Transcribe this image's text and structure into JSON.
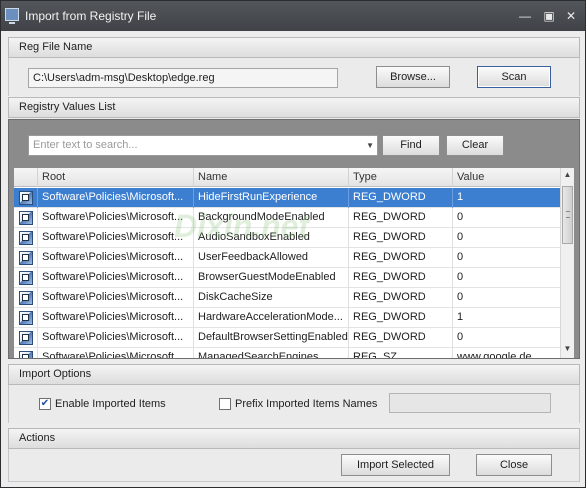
{
  "window": {
    "title": "Import from Registry File"
  },
  "reg_file": {
    "header": "Reg File Name",
    "path": "C:\\Users\\adm-msg\\Desktop\\edge.reg",
    "browse_label": "Browse...",
    "scan_label": "Scan"
  },
  "registry_values": {
    "header": "Registry Values List",
    "search_placeholder": "Enter text to search...",
    "find_label": "Find",
    "clear_label": "Clear",
    "columns": [
      "Root",
      "Name",
      "Type",
      "Value"
    ],
    "rows": [
      {
        "root": "Software\\Policies\\Microsoft...",
        "name": "HideFirstRunExperience",
        "type": "REG_DWORD",
        "value": "1",
        "selected": true
      },
      {
        "root": "Software\\Policies\\Microsoft...",
        "name": "BackgroundModeEnabled",
        "type": "REG_DWORD",
        "value": "0"
      },
      {
        "root": "Software\\Policies\\Microsoft...",
        "name": "AudioSandboxEnabled",
        "type": "REG_DWORD",
        "value": "0"
      },
      {
        "root": "Software\\Policies\\Microsoft...",
        "name": "UserFeedbackAllowed",
        "type": "REG_DWORD",
        "value": "0"
      },
      {
        "root": "Software\\Policies\\Microsoft...",
        "name": "BrowserGuestModeEnabled",
        "type": "REG_DWORD",
        "value": "0"
      },
      {
        "root": "Software\\Policies\\Microsoft...",
        "name": "DiskCacheSize",
        "type": "REG_DWORD",
        "value": "0"
      },
      {
        "root": "Software\\Policies\\Microsoft...",
        "name": "HardwareAccelerationMode...",
        "type": "REG_DWORD",
        "value": "1"
      },
      {
        "root": "Software\\Policies\\Microsoft...",
        "name": "DefaultBrowserSettingEnabled",
        "type": "REG_DWORD",
        "value": "0"
      },
      {
        "root": "Software\\Policies\\Microsoft...",
        "name": "ManagedSearchEngines",
        "type": "REG_SZ",
        "value": "www.google.de"
      }
    ]
  },
  "import_options": {
    "header": "Import Options",
    "enable_label": "Enable Imported Items",
    "enable_checked": true,
    "prefix_label": "Prefix Imported Items Names",
    "prefix_checked": false,
    "prefix_value": ""
  },
  "actions": {
    "header": "Actions",
    "import_label": "Import Selected",
    "close_label": "Close"
  },
  "watermark": "Dixin.net",
  "icons": {
    "app": "monitor-icon",
    "minimize": "minimize-icon",
    "maximize": "maximize-icon",
    "close": "close-icon",
    "row": "registry-value-icon",
    "dropdown": "chevron-down-icon"
  },
  "colors": {
    "selection": "#3c7fd1",
    "titlebar": "#4a4d52",
    "focus_border": "#3a5f9e"
  }
}
